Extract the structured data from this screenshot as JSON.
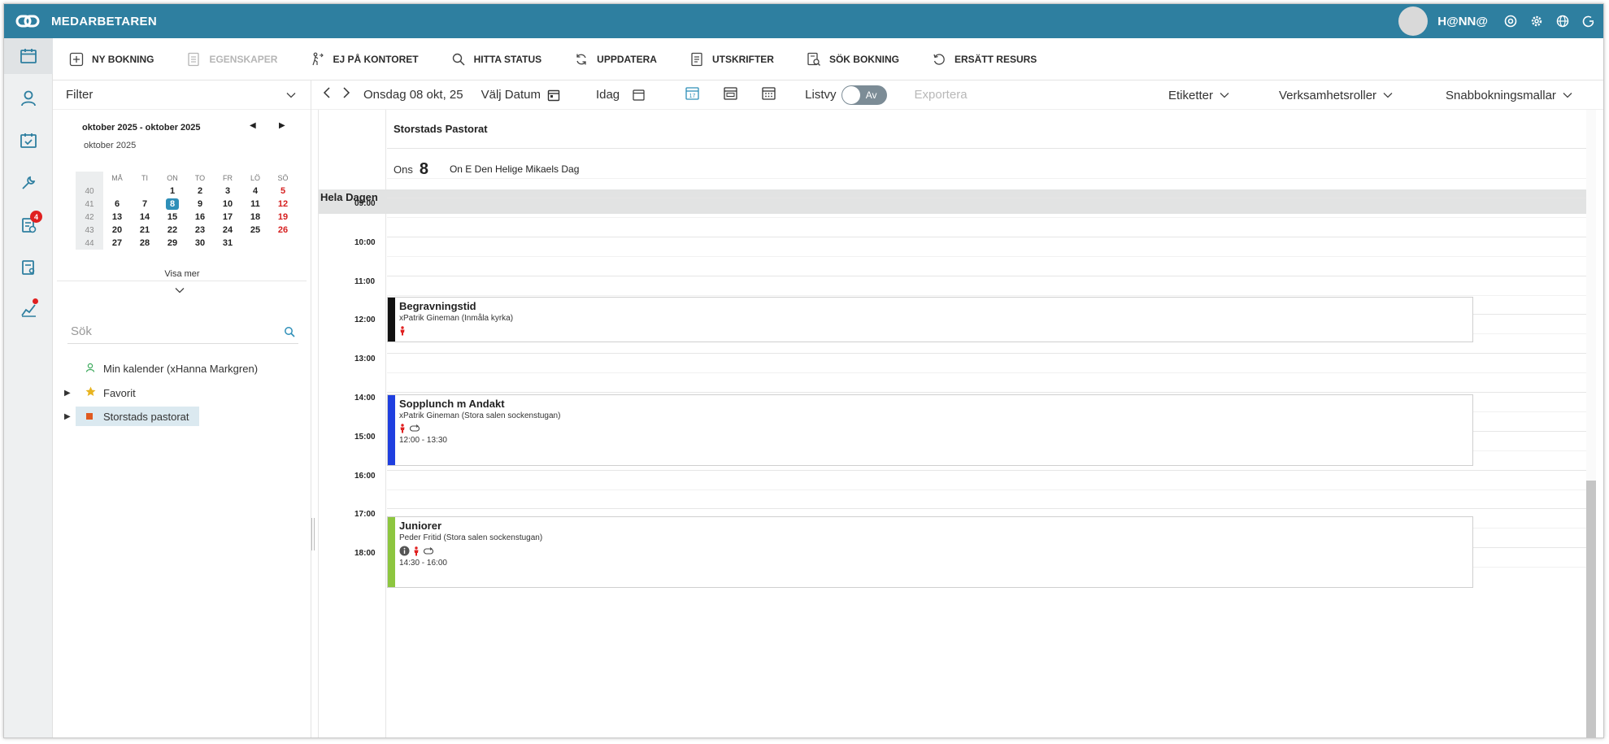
{
  "app": {
    "title": "MEDARBETAREN",
    "user": "H@NN@"
  },
  "toolbar": {
    "new_booking": "NY BOKNING",
    "properties": "EGENSKAPER",
    "not_in_office": "EJ PÅ KONTORET",
    "find_status": "HITTA STATUS",
    "refresh": "UPPDATERA",
    "printouts": "UTSKRIFTER",
    "search_booking": "SÖK BOKNING",
    "replace_resource": "ERSÄTT RESURS"
  },
  "rail": {
    "notification_count": "4"
  },
  "filter": {
    "label": "Filter"
  },
  "mini_calendar": {
    "range": "oktober 2025 - oktober 2025",
    "month": "oktober 2025",
    "weekdays": [
      "MÅ",
      "TI",
      "ON",
      "TO",
      "FR",
      "LÖ",
      "SÖ"
    ],
    "weeks": [
      {
        "wk": "40",
        "days": [
          "",
          "",
          "1",
          "2",
          "3",
          "4",
          "5"
        ]
      },
      {
        "wk": "41",
        "days": [
          "6",
          "7",
          "8",
          "9",
          "10",
          "11",
          "12"
        ]
      },
      {
        "wk": "42",
        "days": [
          "13",
          "14",
          "15",
          "16",
          "17",
          "18",
          "19"
        ]
      },
      {
        "wk": "43",
        "days": [
          "20",
          "21",
          "22",
          "23",
          "24",
          "25",
          "26"
        ]
      },
      {
        "wk": "44",
        "days": [
          "27",
          "28",
          "29",
          "30",
          "31",
          "",
          ""
        ]
      }
    ],
    "today": "8",
    "show_more": "Visa mer"
  },
  "search": {
    "placeholder": "Sök"
  },
  "tree": {
    "my_calendar": "Min kalender (xHanna Markgren)",
    "favorites": "Favorit",
    "parish": "Storstads pastorat"
  },
  "calbar": {
    "current_date": "Onsdag 08 okt, 25",
    "choose_date": "Välj Datum",
    "today": "Idag",
    "list_view": "Listvy",
    "toggle_state": "Av",
    "export": "Exportera",
    "labels": "Etiketter",
    "roles": "Verksamhetsroller",
    "quick_templates": "Snabbokningsmallar"
  },
  "grid": {
    "resource": "Storstads Pastorat",
    "dow": "Ons",
    "day": "8",
    "day_note": "On E Den Helige Mikaels Dag",
    "all_day": "Hela Dagen",
    "hours": [
      "09:00",
      "10:00",
      "11:00",
      "12:00",
      "13:00",
      "14:00",
      "15:00",
      "16:00",
      "17:00",
      "18:00"
    ]
  },
  "events": [
    {
      "title": "Begravningstid",
      "sub": "xPatrik Gineman (Inmåla kyrka)",
      "time": "",
      "color": "#111111"
    },
    {
      "title": "Sopplunch m Andakt",
      "sub": "xPatrik Gineman (Stora salen sockenstugan)",
      "time": "12:00 - 13:30",
      "color": "#1f3fe0"
    },
    {
      "title": "Juniorer",
      "sub": "Peder Fritid (Stora salen sockenstugan)",
      "time": "14:30 - 16:00",
      "color": "#8dc63f"
    }
  ],
  "colors": {
    "header": "#2e7fa0",
    "accent": "#2e8fb8",
    "sunday": "#d62020",
    "badge": "#e02020"
  }
}
